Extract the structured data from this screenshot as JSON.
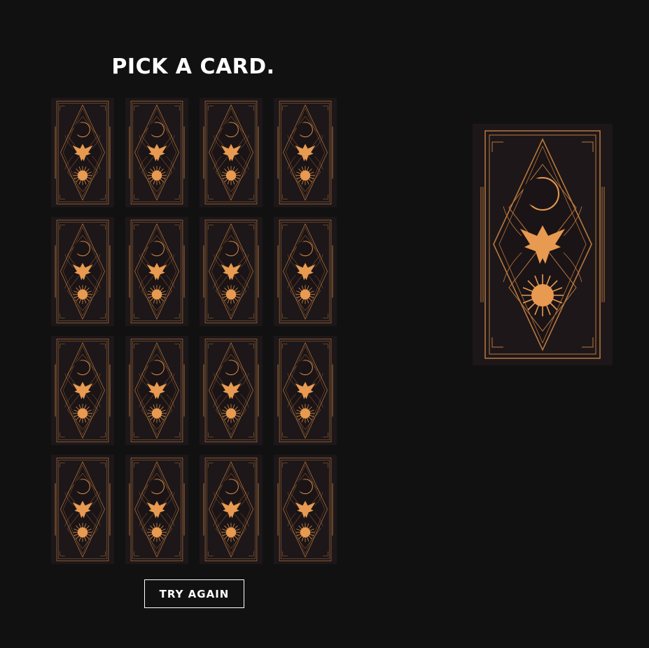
{
  "page": {
    "title": "PICK A CARD.",
    "try_again_label": "TRY AGAIN"
  },
  "deck": {
    "rows": 4,
    "columns": 4,
    "card_back_icon": "tarot-card-back-icon"
  },
  "colors": {
    "background": "#121112",
    "card_face": "#1d1719",
    "card_ink": "#1b1416",
    "gold": "#e79a50",
    "gold_line": "#b9783f",
    "text": "#ffffff"
  }
}
